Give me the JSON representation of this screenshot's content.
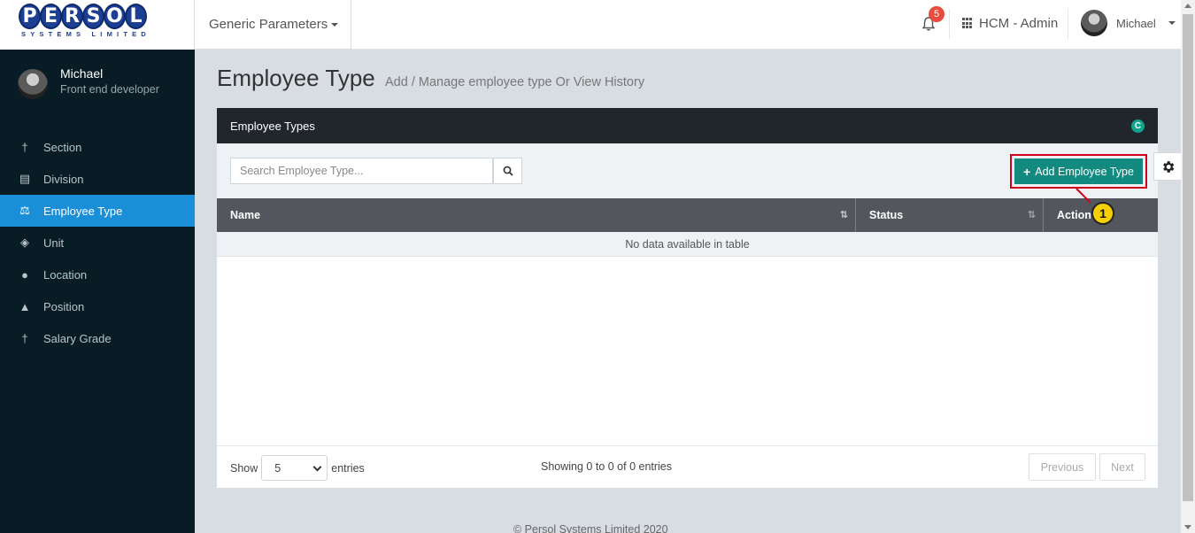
{
  "header": {
    "logo_letters": [
      "P",
      "E",
      "R",
      "S",
      "O",
      "L"
    ],
    "logo_subtitle": "SYSTEMS LIMITED",
    "generic_menu_label": "Generic Parameters",
    "notification_count": "5",
    "app_label": "HCM - Admin",
    "user_name": "Michael"
  },
  "sidebar": {
    "profile_name": "Michael",
    "profile_role": "Front end developer",
    "items": [
      {
        "label": "Section",
        "icon": "pin-icon",
        "active": false
      },
      {
        "label": "Division",
        "icon": "building-icon",
        "active": false
      },
      {
        "label": "Employee Type",
        "icon": "scale-icon",
        "active": true
      },
      {
        "label": "Unit",
        "icon": "tag-icon",
        "active": false
      },
      {
        "label": "Location",
        "icon": "map-pin-icon",
        "active": false
      },
      {
        "label": "Position",
        "icon": "graduation-cap-icon",
        "active": false
      },
      {
        "label": "Salary Grade",
        "icon": "pin-icon",
        "active": false
      }
    ]
  },
  "page": {
    "title": "Employee Type",
    "subtitle": "Add / Manage employee type Or View History"
  },
  "panel": {
    "heading": "Employee Types",
    "search_placeholder": "Search Employee Type...",
    "add_button_label": "Add Employee Type",
    "columns": [
      "Name",
      "Status",
      "Action"
    ],
    "empty_message": "No data available in table",
    "show_label": "Show",
    "page_size": "5",
    "entries_label": "entries",
    "info_text": "Showing 0 to 0 of 0 entries",
    "prev_label": "Previous",
    "next_label": "Next"
  },
  "annotation": {
    "callout_number": "1",
    "highlight_color": "#d0021b"
  },
  "footer": {
    "copyright": "© Persol Systems Limited 2020"
  },
  "colors": {
    "sidebar_bg": "#071c24",
    "active_item": "#1a8fd8",
    "accent_button": "#138a7f",
    "panel_header": "#21262c",
    "table_header": "#53575d",
    "badge": "#e74c3c"
  }
}
